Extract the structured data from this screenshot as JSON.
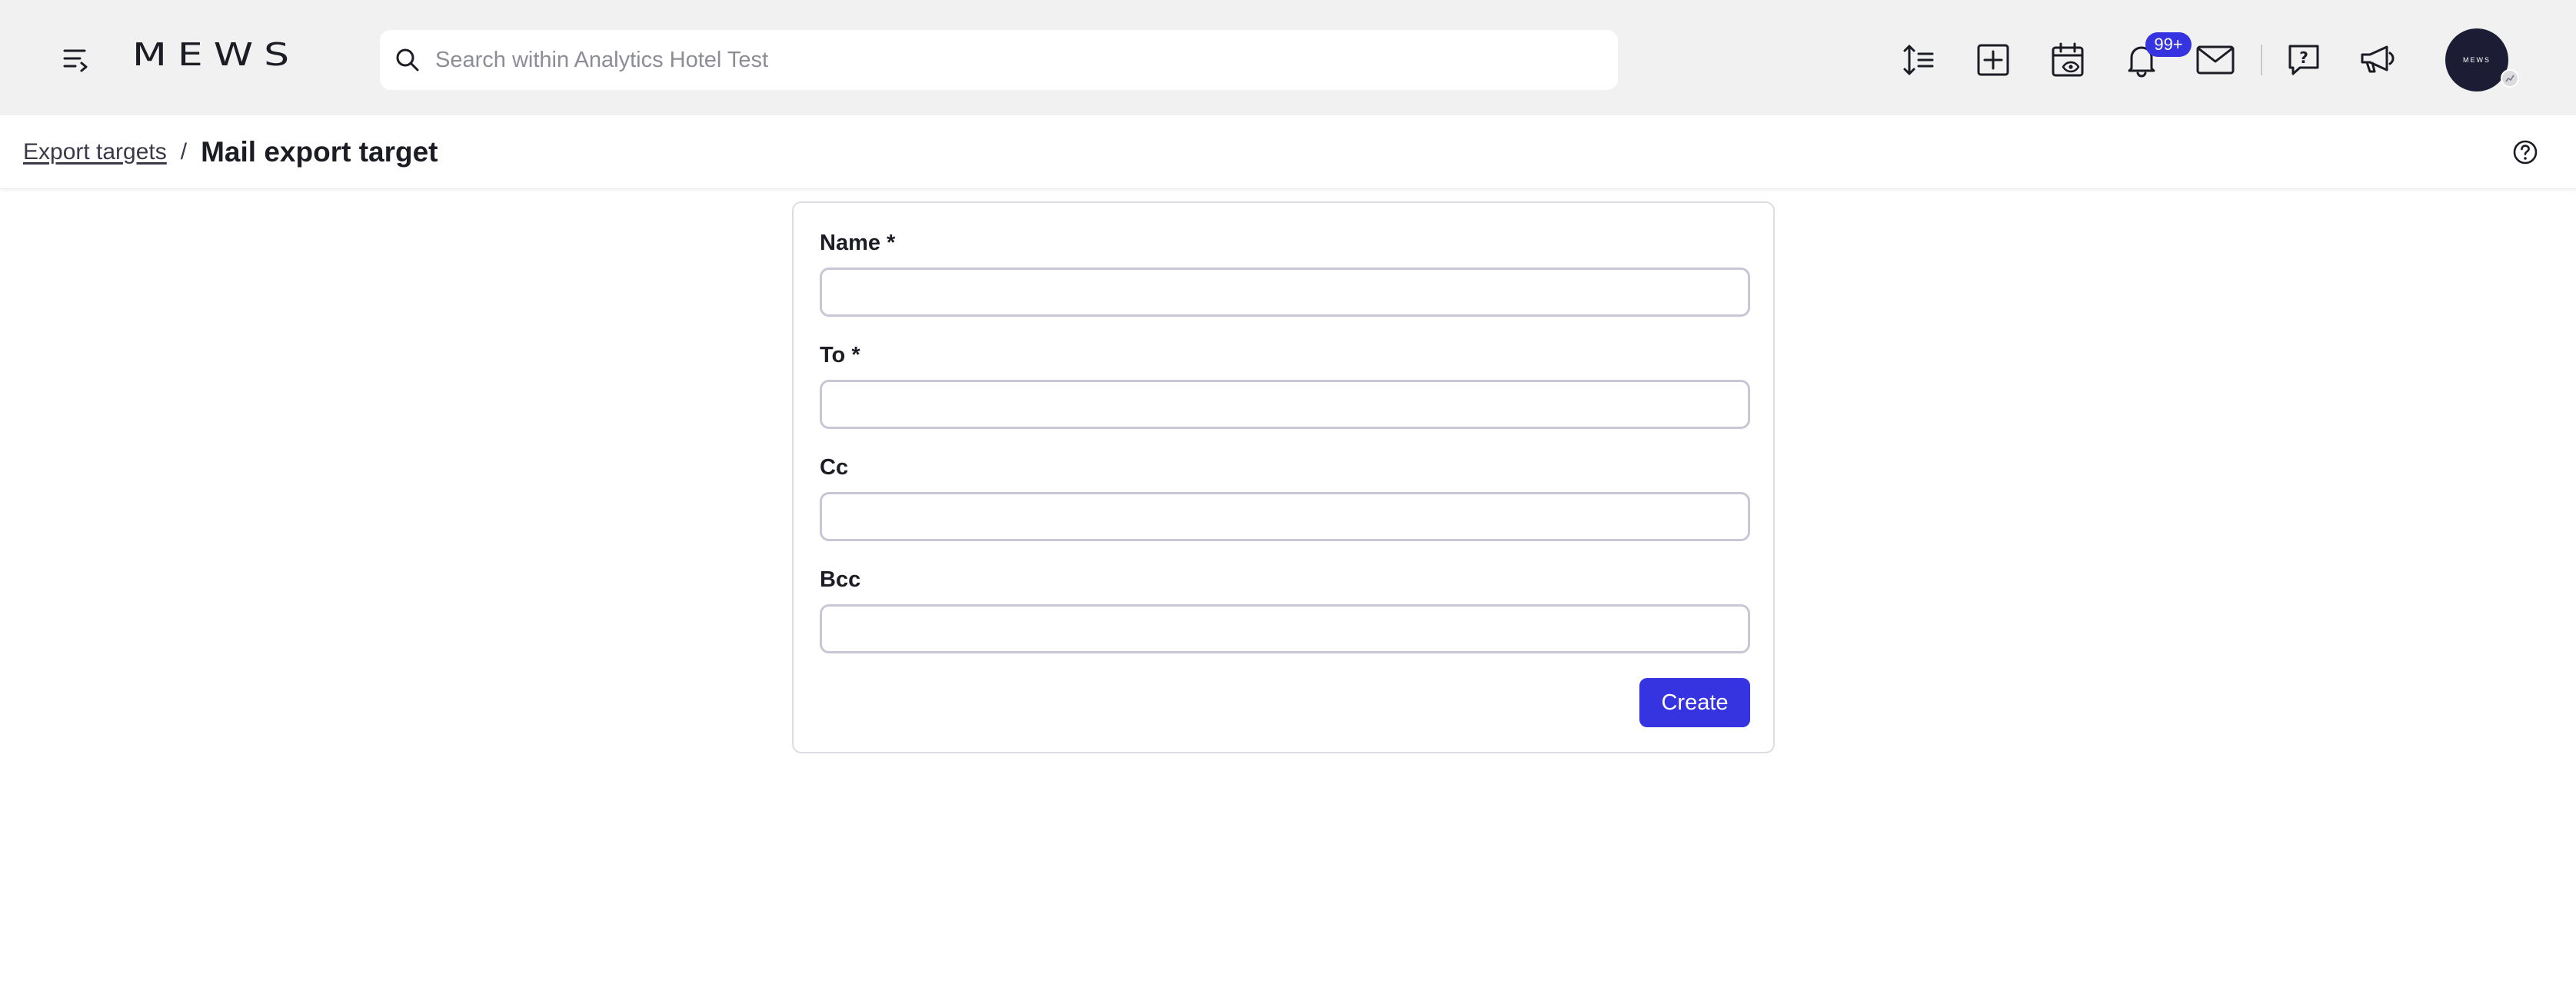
{
  "header": {
    "logo_text": "MEWS",
    "search": {
      "placeholder": "Search within Analytics Hotel Test",
      "value": ""
    },
    "icons": [
      "menu-icon",
      "sort-lines-icon",
      "plus-box-icon",
      "calendar-view-icon",
      "bell-icon",
      "mail-icon",
      "help-chat-icon",
      "megaphone-icon"
    ],
    "notification_badge": "99+",
    "avatar_text": "MEWS"
  },
  "breadcrumb": {
    "link": "Export targets",
    "separator": "/",
    "title": "Mail export target"
  },
  "form": {
    "fields": [
      {
        "label": "Name *",
        "value": ""
      },
      {
        "label": "To *",
        "value": ""
      },
      {
        "label": "Cc",
        "value": ""
      },
      {
        "label": "Bcc",
        "value": ""
      }
    ],
    "submit_label": "Create"
  },
  "colors": {
    "accent": "#3633e0",
    "topbar_bg": "#f1f1f1",
    "text": "#1c1d24"
  }
}
